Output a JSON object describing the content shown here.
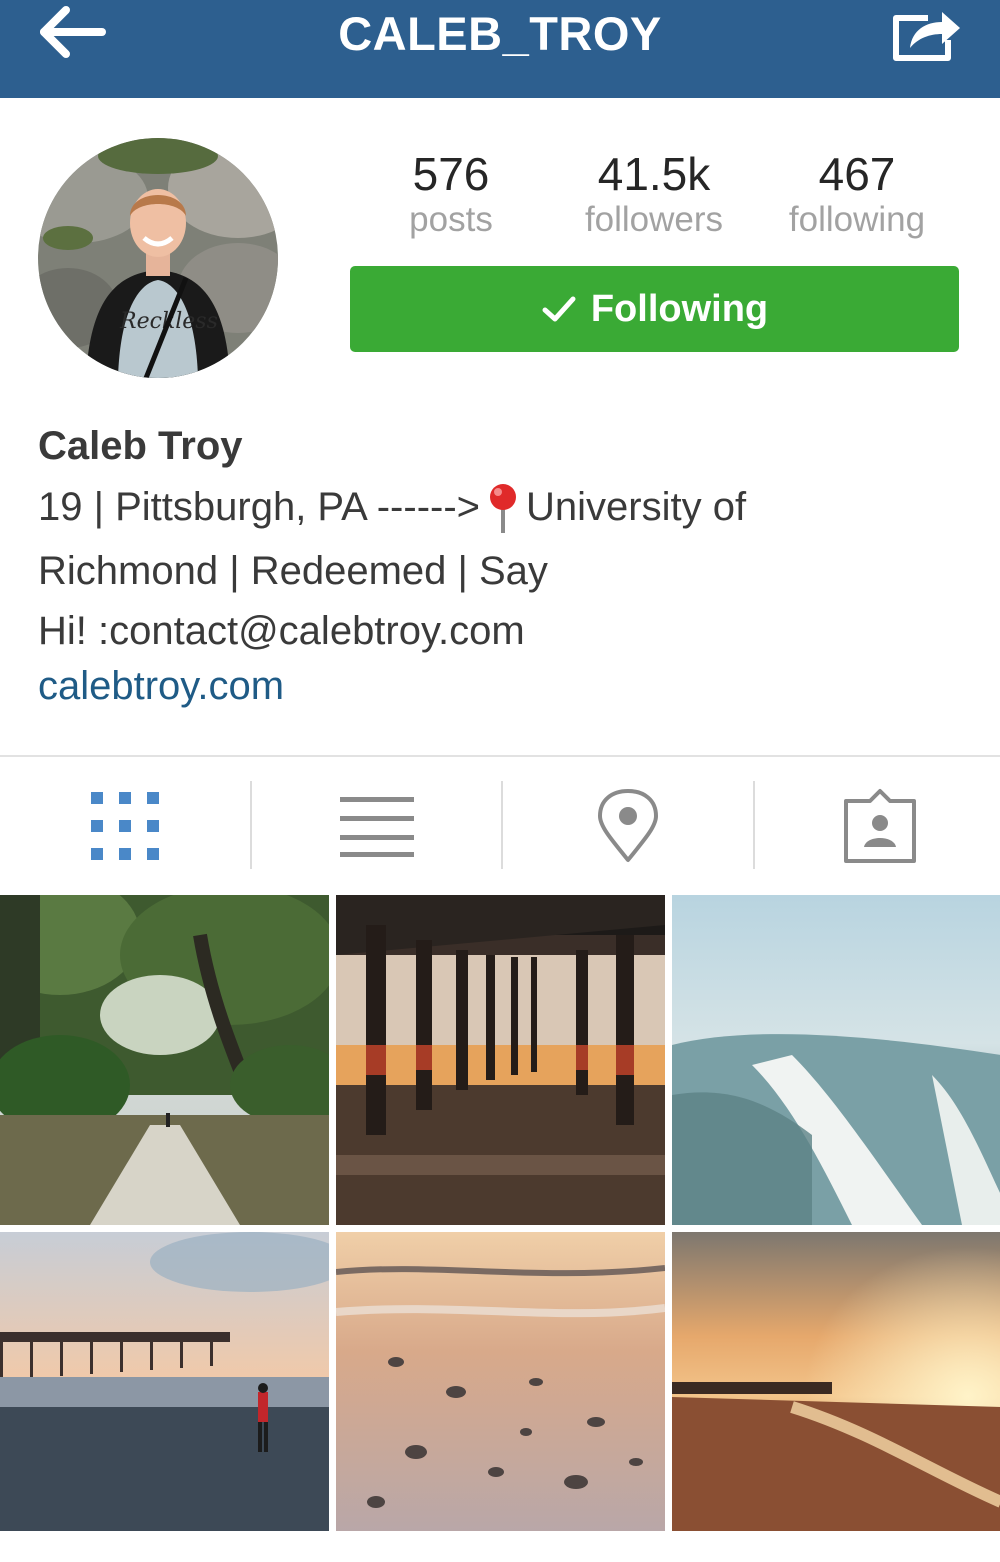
{
  "header": {
    "title": "CALEB_TROY",
    "bar_color": "#2d5f8f"
  },
  "profile": {
    "stats": [
      {
        "value": "576",
        "label": "posts"
      },
      {
        "value": "41.5k",
        "label": "followers"
      },
      {
        "value": "467",
        "label": "following"
      }
    ],
    "follow_button_label": "Following",
    "follow_button_color": "#3aaa35",
    "avatar_shirt_text": "Reckless",
    "name": "Caleb Troy",
    "bio_line1_before_pin": "19 | Pittsburgh, PA ------>",
    "bio_line1_after_pin": "University of",
    "bio_line2": "Richmond | Redeemed | Say",
    "bio_line3": "Hi! :contact@calebtroy.com",
    "website": "calebtroy.com",
    "link_color": "#1f5b86"
  },
  "tabs": [
    {
      "icon": "grid-icon",
      "active": true
    },
    {
      "icon": "list-icon",
      "active": false
    },
    {
      "icon": "location-pin-icon",
      "active": false
    },
    {
      "icon": "tagged-photos-icon",
      "active": false
    }
  ],
  "grid": {
    "photos": [
      "live-oak-path-photo",
      "pier-underside-photo",
      "ocean-waves-photo",
      "pier-beach-walker-photo",
      "wet-sand-pebbles-photo",
      "sunset-beach-photo"
    ]
  }
}
